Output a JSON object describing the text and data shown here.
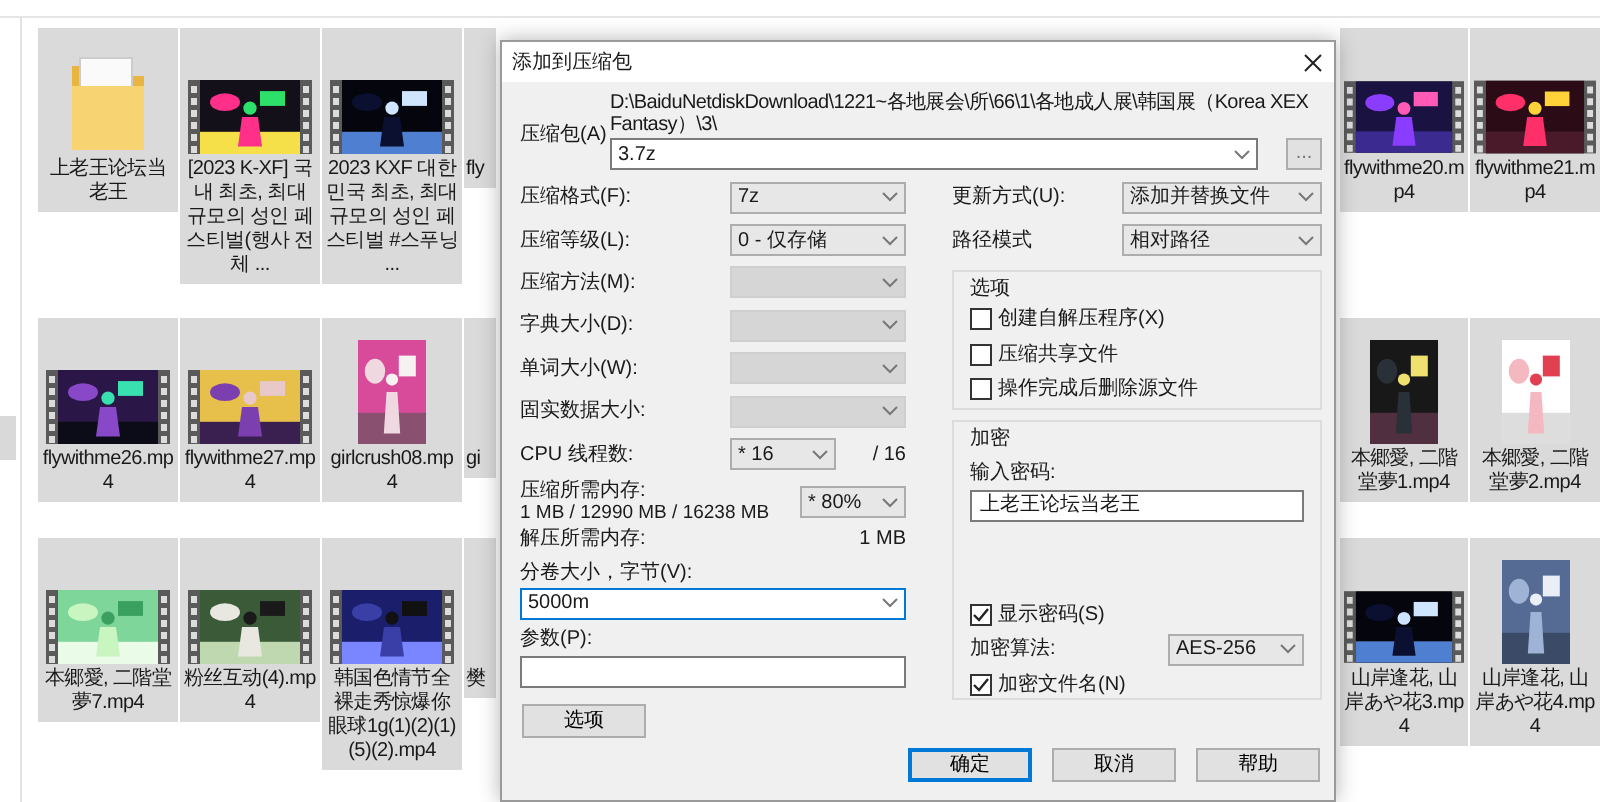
{
  "explorer": {
    "rows": [
      {
        "left": [
          {
            "kind": "folder",
            "label": "上老王论坛当老王",
            "selected": true
          },
          {
            "kind": "video",
            "label": "[2023 K-XF] 국내 최초, 최대 규모의 성인 페스티벌(행사 전체 ...",
            "selected": true
          },
          {
            "kind": "video",
            "label": "2023 KXF 대한민국 최초, 최대 규모의 성인 페스티벌 #스푸닝 ...",
            "selected": true
          },
          {
            "kind": "partial",
            "label": "fly",
            "selected": true
          }
        ],
        "right": [
          {
            "kind": "video",
            "label": "flywithme20.mp4",
            "selected": true
          },
          {
            "kind": "video",
            "label": "flywithme21.mp4",
            "selected": true
          }
        ]
      },
      {
        "left": [
          {
            "kind": "video",
            "label": "flywithme26.mp4",
            "selected": true
          },
          {
            "kind": "video",
            "label": "flywithme27.mp4",
            "selected": true
          },
          {
            "kind": "portrait",
            "label": "girlcrush08.mp4",
            "selected": true
          },
          {
            "kind": "partial",
            "label": "gi",
            "selected": true
          }
        ],
        "right": [
          {
            "kind": "portrait",
            "label": "本郷愛, 二階堂夢1.mp4",
            "selected": true
          },
          {
            "kind": "portrait",
            "label": "本郷愛, 二階堂夢2.mp4",
            "selected": true
          }
        ]
      },
      {
        "left": [
          {
            "kind": "video",
            "label": "本郷愛, 二階堂夢7.mp4",
            "selected": true
          },
          {
            "kind": "video",
            "label": "粉丝互动(4).mp4",
            "selected": true
          },
          {
            "kind": "video",
            "label": "韩国色情节全裸走秀惊爆你眼球1g(1)(2)(1)(5)(2).mp4",
            "selected": true
          },
          {
            "kind": "partial",
            "label": "樊",
            "selected": true
          }
        ],
        "right": [
          {
            "kind": "video",
            "label": "山岸逢花, 山岸あや花3.mp4",
            "selected": true
          },
          {
            "kind": "portrait",
            "label": "山岸逢花, 山岸あや花4.mp4",
            "selected": true
          }
        ]
      }
    ]
  },
  "dialog": {
    "title": "添加到压缩包",
    "archive": {
      "label": "压缩包(A)",
      "path": "D:\\BaiduNetdiskDownload\\1221~各地展会\\所\\66\\1\\各地成人展\\韩国展（Korea XEX Fantasy）\\3\\",
      "value": "3.7z",
      "browse": "..."
    },
    "left_fields": [
      {
        "kind": "combo",
        "label": "压缩格式(F):",
        "value": "7z",
        "disabled": false
      },
      {
        "kind": "combo",
        "label": "压缩等级(L):",
        "value": "0 - 仅存储",
        "disabled": false
      },
      {
        "kind": "combo",
        "label": "压缩方法(M):",
        "disabled": true
      },
      {
        "kind": "combo",
        "label": "字典大小(D):",
        "disabled": true
      },
      {
        "kind": "combo",
        "label": "单词大小(W):",
        "disabled": true
      },
      {
        "kind": "combo",
        "label": "固实数据大小:",
        "disabled": true
      },
      {
        "kind": "threads",
        "label": "CPU 线程数:",
        "value": "* 16",
        "suffix": "/ 16",
        "disabled": false
      },
      {
        "kind": "memory",
        "label": "压缩所需内存:",
        "detail": "1 MB / 12990 MB / 16238 MB",
        "value": "* 80%",
        "disabled": false
      },
      {
        "kind": "info",
        "label": "解压所需内存:",
        "value": "1 MB"
      },
      {
        "kind": "wide_combo",
        "label": "分卷大小，字节(V):",
        "value": "5000m",
        "focused": true
      },
      {
        "kind": "wide_input",
        "label": "参数(P):"
      }
    ],
    "options_button": "选项",
    "right_fields": [
      {
        "label": "更新方式(U):",
        "value": "添加并替换文件"
      },
      {
        "label": "路径模式",
        "value": "相对路径"
      }
    ],
    "options_group": {
      "title": "选项",
      "checkboxes": [
        {
          "label": "创建自解压程序(X)",
          "checked": false
        },
        {
          "label": "压缩共享文件",
          "checked": false
        },
        {
          "label": "操作完成后删除源文件",
          "checked": false
        }
      ]
    },
    "encryption": {
      "title": "加密",
      "password_label": "输入密码:",
      "password": "上老王论坛当老王",
      "show_password": {
        "label": "显示密码(S)",
        "checked": true
      },
      "method_label": "加密算法:",
      "method": "AES-256",
      "encrypt_names": {
        "label": "加密文件名(N)",
        "checked": true
      }
    },
    "buttons": [
      {
        "label": "确定",
        "default": true
      },
      {
        "label": "取消",
        "default": false
      },
      {
        "label": "帮助",
        "default": false
      }
    ]
  }
}
